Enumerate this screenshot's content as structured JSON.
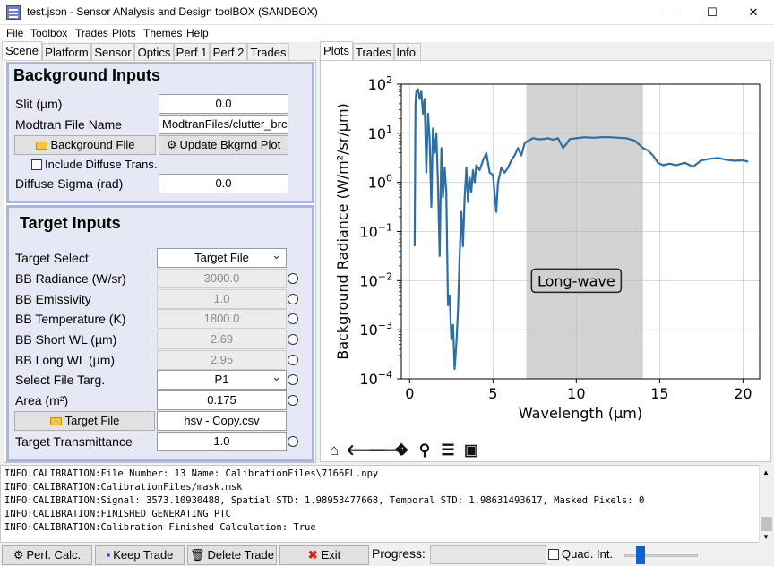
{
  "window": {
    "title": "test.json - Sensor ANalysis and Design toolBOX (SANDBOX)",
    "minimize": "—",
    "maximize": "☐",
    "close": "✕"
  },
  "menu": [
    "File",
    "Toolbox",
    "Trades",
    "Plots",
    "Themes",
    "Help"
  ],
  "left_tabs": [
    "Scene",
    "Platform",
    "Sensor",
    "Optics",
    "Perf 1",
    "Perf 2",
    "Trades"
  ],
  "right_tabs": [
    "Plots",
    "Trades",
    "Info."
  ],
  "background": {
    "title": "Background Inputs",
    "slit_label": "Slit (µm)",
    "slit_value": "0.0",
    "modtran_label": "Modtran File Name",
    "modtran_value": "ModtranFiles/clutter_brc",
    "bg_file_button": "Background File",
    "update_button": "Update Bkgrnd Plot",
    "diffuse_trans_label": "Include Diffuse Trans.",
    "diffuse_sigma_label": "Diffuse Sigma (rad)",
    "diffuse_sigma_value": "0.0"
  },
  "target": {
    "title": "Target Inputs",
    "select_label": "Target Select",
    "select_value": "Target File",
    "bb_radiance_label": "BB Radiance (W/sr)",
    "bb_radiance_value": "3000.0",
    "bb_emissivity_label": "BB Emissivity",
    "bb_emissivity_value": "1.0",
    "bb_temperature_label": "BB Temperature (K)",
    "bb_temperature_value": "1800.0",
    "bb_short_label": "BB Short WL (µm)",
    "bb_short_value": "2.69",
    "bb_long_label": "BB Long WL (µm)",
    "bb_long_value": "2.95",
    "file_targ_label": "Select File Targ.",
    "file_targ_value": "P1",
    "area_label": "Area (m²)",
    "area_value": "0.175",
    "target_file_button": "Target File",
    "target_file_value": "hsv - Copy.csv",
    "transmittance_label": "Target Transmittance",
    "transmittance_value": "1.0"
  },
  "chart_data": {
    "type": "line",
    "xlabel": "Wavelength (µm)",
    "ylabel": "Background Radiance (W/m²/sr/µm)",
    "xlim": [
      -0.5,
      21
    ],
    "ylim_log10": [
      -4,
      2
    ],
    "x_ticks": [
      0,
      5,
      10,
      15,
      20
    ],
    "y_tick_labels": [
      {
        "base": "10",
        "exp": "2",
        "v": 2
      },
      {
        "base": "10",
        "exp": "1",
        "v": 1
      },
      {
        "base": "10",
        "exp": "0",
        "v": 0
      },
      {
        "base": "10",
        "exp": "−1",
        "v": -1
      },
      {
        "base": "10",
        "exp": "−2",
        "v": -2
      },
      {
        "base": "10",
        "exp": "−3",
        "v": -3
      },
      {
        "base": "10",
        "exp": "−4",
        "v": -4
      }
    ],
    "shaded_band": [
      7,
      14
    ],
    "annotation": "Long-wave",
    "annotation_at": [
      10,
      -2
    ],
    "grid": true,
    "line_color": "#2c6ea6",
    "series": [
      {
        "points": [
          [
            0.3,
            -1.3
          ],
          [
            0.35,
            1.6
          ],
          [
            0.4,
            1.85
          ],
          [
            0.5,
            1.9
          ],
          [
            0.6,
            1.7
          ],
          [
            0.7,
            1.85
          ],
          [
            0.8,
            1.4
          ],
          [
            0.9,
            1.7
          ],
          [
            1.0,
            0.2
          ],
          [
            1.1,
            1.4
          ],
          [
            1.2,
            0.9
          ],
          [
            1.3,
            -0.5
          ],
          [
            1.4,
            1.1
          ],
          [
            1.5,
            0.6
          ],
          [
            1.6,
            1.0
          ],
          [
            1.7,
            0.0
          ],
          [
            1.8,
            -1.5
          ],
          [
            1.9,
            0.7
          ],
          [
            2.0,
            -0.3
          ],
          [
            2.1,
            0.3
          ],
          [
            2.2,
            -0.2
          ],
          [
            2.3,
            -2.5
          ],
          [
            2.4,
            -2.3
          ],
          [
            2.5,
            -3.2
          ],
          [
            2.6,
            -2.9
          ],
          [
            2.7,
            -3.8
          ],
          [
            2.8,
            -3.3
          ],
          [
            2.9,
            -2.6
          ],
          [
            3.0,
            -1.5
          ],
          [
            3.1,
            -0.6
          ],
          [
            3.2,
            -1.3
          ],
          [
            3.3,
            -0.3
          ],
          [
            3.4,
            0.3
          ],
          [
            3.5,
            -0.4
          ],
          [
            3.6,
            0.1
          ],
          [
            3.7,
            -0.2
          ],
          [
            3.8,
            0.25
          ],
          [
            3.9,
            0.0
          ],
          [
            4.0,
            0.35
          ],
          [
            4.2,
            0.25
          ],
          [
            4.4,
            0.45
          ],
          [
            4.6,
            0.6
          ],
          [
            4.8,
            0.2
          ],
          [
            5.0,
            0.15
          ],
          [
            5.2,
            -0.6
          ],
          [
            5.3,
            0.0
          ],
          [
            5.5,
            0.3
          ],
          [
            5.7,
            0.2
          ],
          [
            5.9,
            0.3
          ],
          [
            6.1,
            0.45
          ],
          [
            6.3,
            0.55
          ],
          [
            6.5,
            0.7
          ],
          [
            6.7,
            0.55
          ],
          [
            6.9,
            0.8
          ],
          [
            7.1,
            0.85
          ],
          [
            7.4,
            0.9
          ],
          [
            7.7,
            0.88
          ],
          [
            8.0,
            0.88
          ],
          [
            8.3,
            0.9
          ],
          [
            8.6,
            0.87
          ],
          [
            8.9,
            0.9
          ],
          [
            9.2,
            0.7
          ],
          [
            9.4,
            0.78
          ],
          [
            9.6,
            0.88
          ],
          [
            10.0,
            0.9
          ],
          [
            10.5,
            0.92
          ],
          [
            11.0,
            0.91
          ],
          [
            11.5,
            0.92
          ],
          [
            12.0,
            0.92
          ],
          [
            12.5,
            0.91
          ],
          [
            13.0,
            0.9
          ],
          [
            13.5,
            0.85
          ],
          [
            14.0,
            0.7
          ],
          [
            14.3,
            0.65
          ],
          [
            14.6,
            0.55
          ],
          [
            14.9,
            0.4
          ],
          [
            15.2,
            0.35
          ],
          [
            15.6,
            0.38
          ],
          [
            16.0,
            0.35
          ],
          [
            16.5,
            0.4
          ],
          [
            17.0,
            0.32
          ],
          [
            17.5,
            0.45
          ],
          [
            18.0,
            0.48
          ],
          [
            18.5,
            0.5
          ],
          [
            19.0,
            0.46
          ],
          [
            19.5,
            0.44
          ],
          [
            20.0,
            0.45
          ],
          [
            20.3,
            0.42
          ]
        ]
      }
    ]
  },
  "log_lines": [
    "INFO:CALIBRATION:File Number: 13 Name: CalibrationFiles\\7166FL.npy",
    "INFO:CALIBRATION:CalibrationFiles/mask.msk",
    "INFO:CALIBRATION:Signal: 3573.10930488, Spatial STD: 1.98953477668, Temporal STD: 1.98631493617, Masked Pixels:  0",
    "INFO:CALIBRATION:FINISHED GENERATING PTC",
    "INFO:CALIBRATION:Calibration Finished Calculation: True"
  ],
  "bottom": {
    "perf_calc": "Perf. Calc.",
    "keep_trade": "Keep Trade",
    "delete_trade": "Delete Trade",
    "exit": "Exit",
    "progress_label": "Progress:",
    "quad_int": "Quad. Int."
  },
  "colors": {
    "group_bg": "#e6e8f6",
    "group_border": "#a7b6e8",
    "shade": "#d3d3d3",
    "line": "#2c6ea6"
  }
}
